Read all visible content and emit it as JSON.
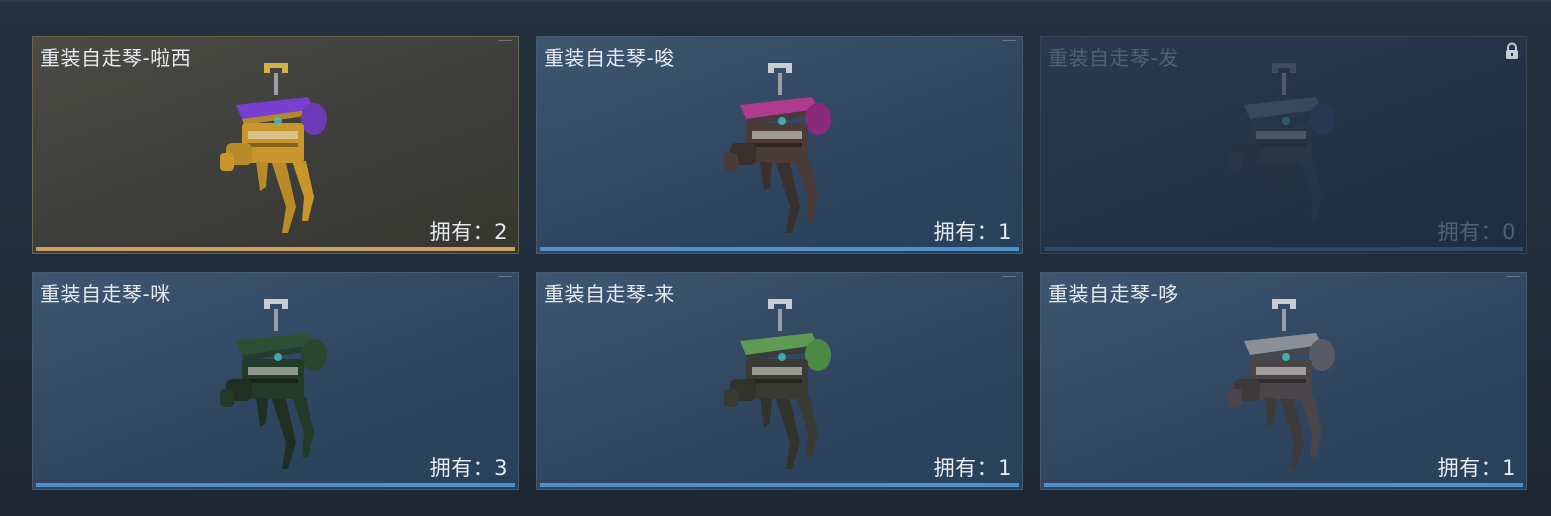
{
  "items": [
    {
      "name": "重装自走琴-啦西",
      "owned": "拥有：2",
      "rarity": "gold",
      "locked": false,
      "colors": {
        "roof": "#7a3fd1",
        "body": "#c8962c",
        "side": "#6c3ab5",
        "leg": "#b88a2a",
        "hook": "#d4b24a"
      }
    },
    {
      "name": "重装自走琴-唆",
      "owned": "拥有：1",
      "rarity": "blue",
      "locked": false,
      "colors": {
        "roof": "#b03a8e",
        "body": "#4a3a38",
        "side": "#8a2a7a",
        "leg": "#3a302e",
        "hook": "#c9ccd0"
      }
    },
    {
      "name": "重装自走琴-发",
      "owned": "拥有：0",
      "rarity": "blue",
      "locked": true,
      "colors": {
        "roof": "#5e6f80",
        "body": "#2c3c4a",
        "side": "#34406a",
        "leg": "#26323e",
        "hook": "#6a7888"
      }
    },
    {
      "name": "重装自走琴-咪",
      "owned": "拥有：3",
      "rarity": "blue",
      "locked": false,
      "colors": {
        "roof": "#2f4f34",
        "body": "#233a28",
        "side": "#2a472e",
        "leg": "#1f2f22",
        "hook": "#c9ccd0"
      }
    },
    {
      "name": "重装自走琴-来",
      "owned": "拥有：1",
      "rarity": "blue",
      "locked": false,
      "colors": {
        "roof": "#5f9a52",
        "body": "#3a3a34",
        "side": "#4d8a46",
        "leg": "#33332e",
        "hook": "#c9ccd0"
      }
    },
    {
      "name": "重装自走琴-哆",
      "owned": "拥有：1",
      "rarity": "blue",
      "locked": false,
      "colors": {
        "roof": "#8a8f98",
        "body": "#4a4548",
        "side": "#5a5a66",
        "leg": "#3e3a3c",
        "hook": "#c9ccd0"
      }
    }
  ],
  "accents": {
    "gold_bar": "#c9a25f",
    "blue_bar": "#4e90c8"
  },
  "icons": {
    "lock": "lock-icon"
  }
}
